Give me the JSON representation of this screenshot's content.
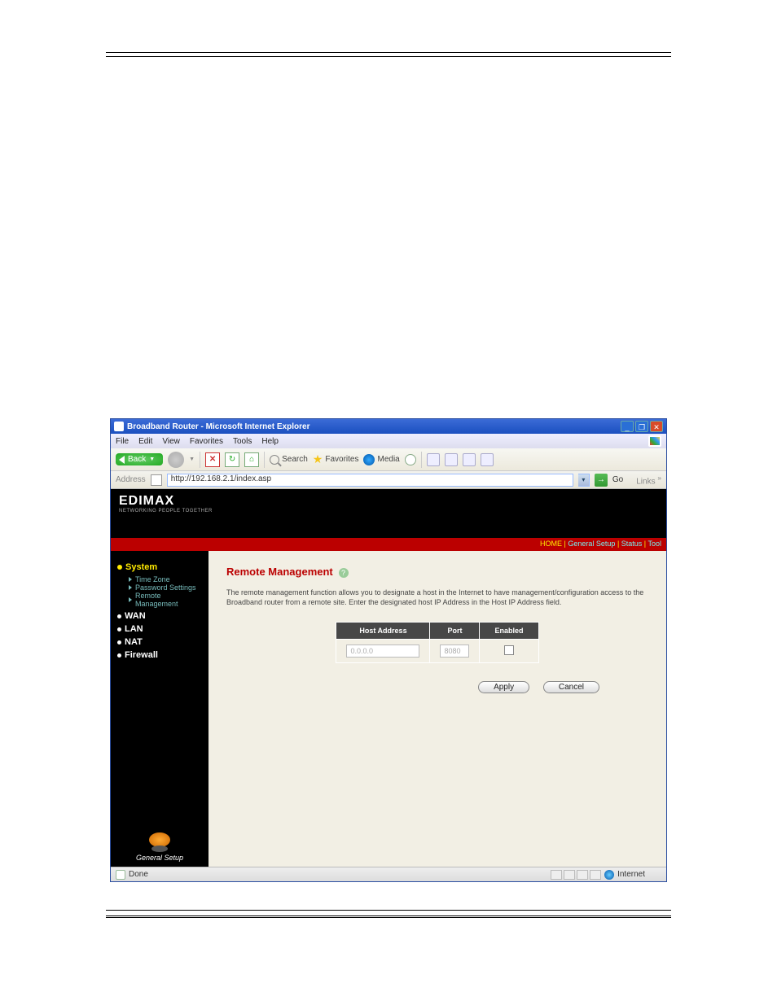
{
  "browser": {
    "window_title": "Broadband Router - Microsoft Internet Explorer",
    "menu": {
      "file": "File",
      "edit": "Edit",
      "view": "View",
      "favorites": "Favorites",
      "tools": "Tools",
      "help": "Help"
    },
    "toolbar": {
      "back": "Back",
      "search": "Search",
      "favorites": "Favorites",
      "media": "Media"
    },
    "address_label": "Address",
    "address_value": "http://192.168.2.1/index.asp",
    "go": "Go",
    "links": "Links",
    "status_done": "Done",
    "status_zone": "Internet"
  },
  "logo": {
    "brand": "EDIMAX",
    "tagline": "NETWORKING PEOPLE TOGETHER"
  },
  "topnav": {
    "home": "HOME",
    "general": "General Setup",
    "status": "Status",
    "tool": "Tool",
    "sep": " | "
  },
  "sidebar": {
    "system": "System",
    "time_zone": "Time Zone",
    "password": "Password Settings",
    "remote": "Remote Management",
    "wan": "WAN",
    "lan": "LAN",
    "nat": "NAT",
    "firewall": "Firewall",
    "general_setup": "General Setup"
  },
  "main": {
    "title": "Remote Management",
    "help": "?",
    "description": "The remote management function allows you to designate a host in the Internet to have management/configuration access to the Broadband router from a remote site. Enter the designated host IP Address in the Host IP Address field.",
    "table": {
      "headers": {
        "host": "Host Address",
        "port": "Port",
        "enabled": "Enabled"
      },
      "host_value": "0.0.0.0",
      "port_value": "8080"
    },
    "buttons": {
      "apply": "Apply",
      "cancel": "Cancel"
    }
  }
}
